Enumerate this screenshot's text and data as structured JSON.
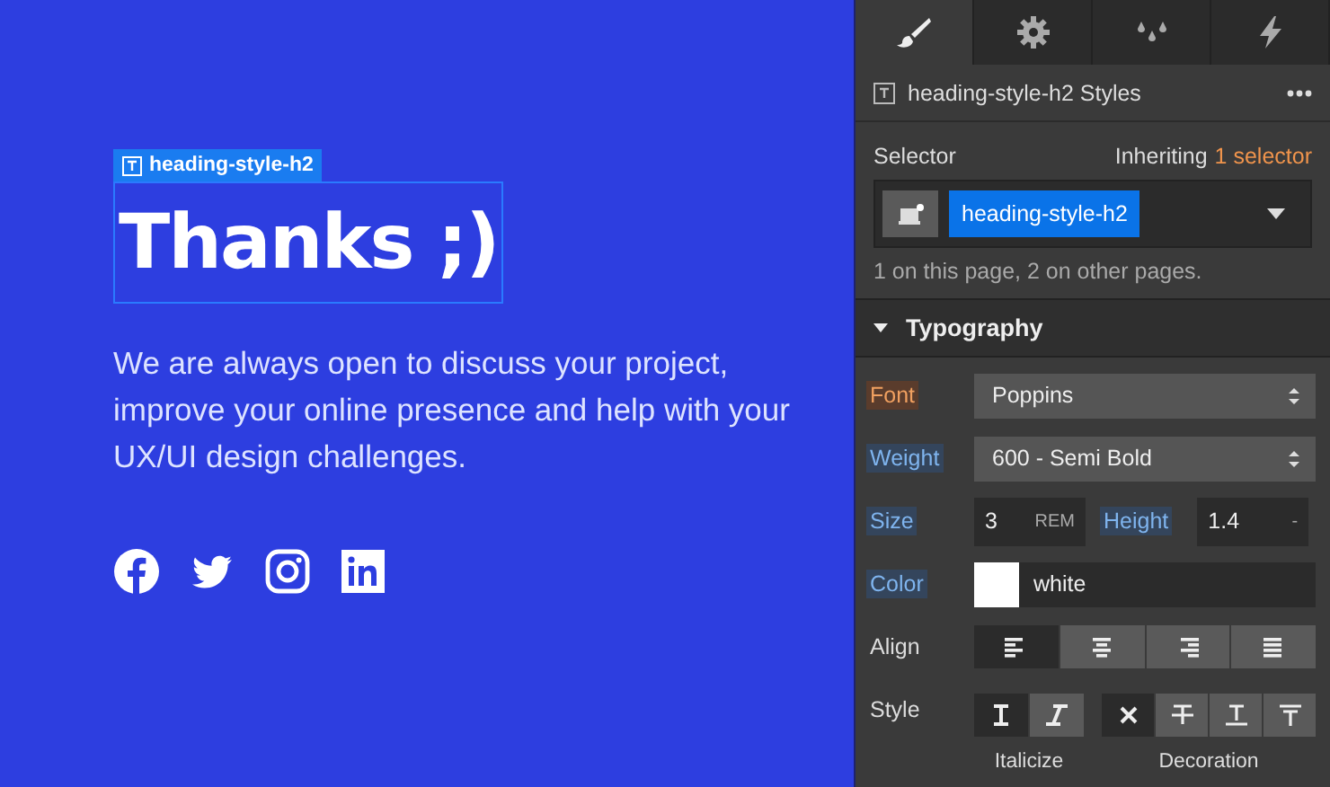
{
  "canvas": {
    "element_badge": "heading-style-h2",
    "heading": "Thanks ;)",
    "paragraph": "We are always open to discuss your project, improve your online presence and help with your UX/UI design challenges.",
    "social": [
      {
        "kind": "facebook"
      },
      {
        "kind": "twitter"
      },
      {
        "kind": "instagram"
      },
      {
        "kind": "linkedin"
      }
    ]
  },
  "panel": {
    "tabs": [
      {
        "kind": "brush",
        "selected": true
      },
      {
        "kind": "gear",
        "selected": false
      },
      {
        "kind": "drops",
        "selected": false
      },
      {
        "kind": "bolt",
        "selected": false
      }
    ],
    "header": {
      "title": "heading-style-h2 Styles"
    },
    "selector": {
      "label": "Selector",
      "inheriting": "Inheriting",
      "inheriting_link": "1 selector",
      "chip": "heading-style-h2",
      "usage": "1 on this page, 2 on other pages."
    },
    "section": {
      "title": "Typography",
      "expanded": true
    },
    "font": {
      "label": "Font",
      "inherited": true,
      "set": false,
      "value": "Poppins"
    },
    "weight": {
      "label": "Weight",
      "inherited": false,
      "set": true,
      "value": "600 - Semi Bold"
    },
    "size": {
      "label": "Size",
      "inherited": false,
      "set": true,
      "value": "3",
      "unit": "REM"
    },
    "height": {
      "label": "Height",
      "inherited": false,
      "set": true,
      "value": "1.4",
      "unit": "-"
    },
    "color": {
      "label": "Color",
      "inherited": false,
      "set": true,
      "color": "#ffffff",
      "value": "white"
    },
    "align": {
      "label": "Align",
      "options": [
        {
          "kind": "left",
          "selected": true
        },
        {
          "kind": "center",
          "selected": false
        },
        {
          "kind": "right",
          "selected": false
        },
        {
          "kind": "justify",
          "selected": false
        }
      ]
    },
    "style": {
      "label": "Style",
      "italic": [
        {
          "kind": "normal",
          "selected": true
        },
        {
          "kind": "italic",
          "selected": false
        }
      ],
      "decoration": [
        {
          "kind": "none",
          "selected": true
        },
        {
          "kind": "strike",
          "selected": false
        },
        {
          "kind": "underline",
          "selected": false
        },
        {
          "kind": "overline",
          "selected": false
        }
      ],
      "italic_caption": "Italicize",
      "decoration_caption": "Decoration"
    }
  }
}
